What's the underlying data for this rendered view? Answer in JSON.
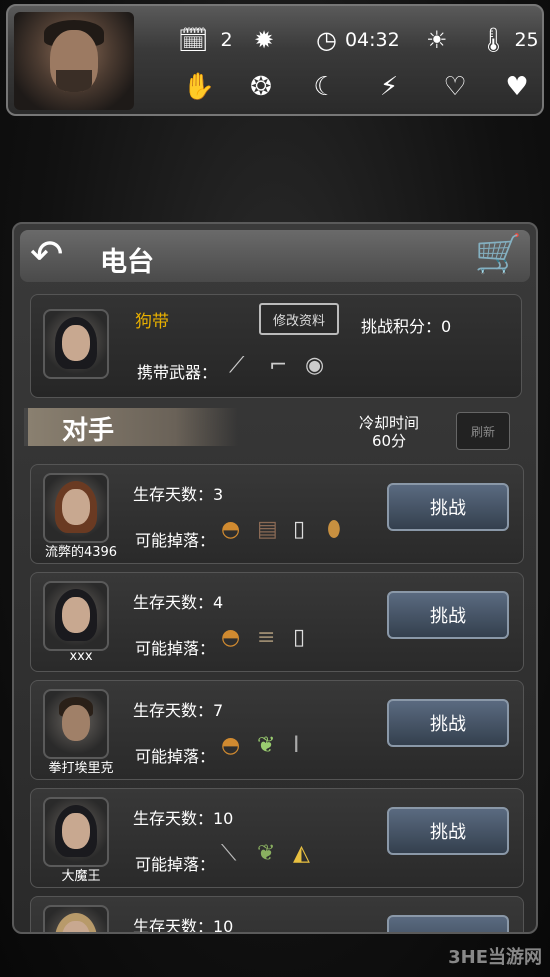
{
  "hud": {
    "day": "2",
    "time": "04:32",
    "temperature": "25"
  },
  "header": {
    "title": "电台"
  },
  "profile": {
    "name": "狗带",
    "edit_button": "修改资料",
    "score_label": "挑战积分：0",
    "weapons_label": "携带武器："
  },
  "rivals": {
    "title": "对手",
    "cooldown_label": "冷却时间",
    "cooldown_value": "60分",
    "refresh_button": "刷新"
  },
  "opponents": [
    {
      "name": "流弊的4396",
      "days": "生存天数：3",
      "drops_label": "可能掉落：",
      "challenge": "挑战"
    },
    {
      "name": "xxx",
      "days": "生存天数：4",
      "drops_label": "可能掉落：",
      "challenge": "挑战"
    },
    {
      "name": "拳打埃里克",
      "days": "生存天数：7",
      "drops_label": "可能掉落：",
      "challenge": "挑战"
    },
    {
      "name": "大魔王",
      "days": "生存天数：10",
      "drops_label": "可能掉落：",
      "challenge": "挑战"
    },
    {
      "name": "",
      "days": "生存天数：10",
      "drops_label": "",
      "challenge": ""
    }
  ],
  "watermark": "3HE当游网",
  "colors": {
    "player_name": "#e8b000",
    "challenge_button": "#4a5a6e",
    "cart": "#d9a520"
  }
}
